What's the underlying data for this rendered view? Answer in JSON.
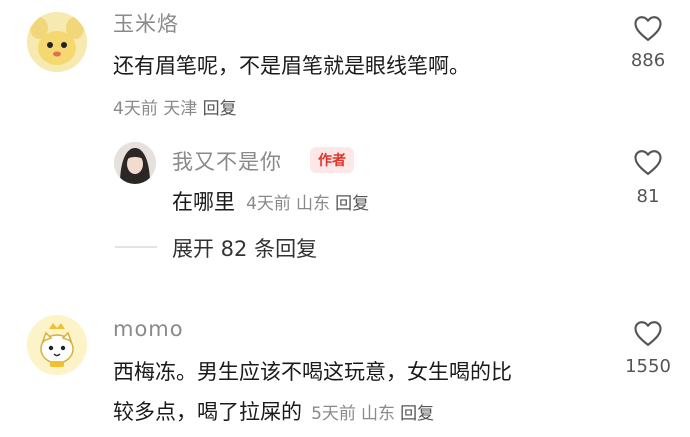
{
  "comments": [
    {
      "user": "玉米烙",
      "text": "还有眉笔呢，不是眉笔就是眼线笔啊。",
      "time": "4天前",
      "location": "天津",
      "reply_label": "回复",
      "likes": "886"
    },
    {
      "user": "momo",
      "text_line1": "西梅冻。男生应该不喝这玩意，女生喝的比",
      "text_line2": "较多点，喝了拉屎的",
      "time": "5天前",
      "location": "山东",
      "reply_label": "回复",
      "likes": "1550"
    }
  ],
  "reply": {
    "user": "我又不是你",
    "badge": "作者",
    "text": "在哪里",
    "time": "4天前",
    "location": "山东",
    "reply_label": "回复",
    "likes": "81"
  },
  "expand_label": "展开 82 条回复",
  "colors": {
    "meta": "#8a8a8a",
    "badge_bg": "#fde7e7",
    "badge_text": "#e4322d"
  },
  "icons": [
    "heart-outline-icon"
  ]
}
